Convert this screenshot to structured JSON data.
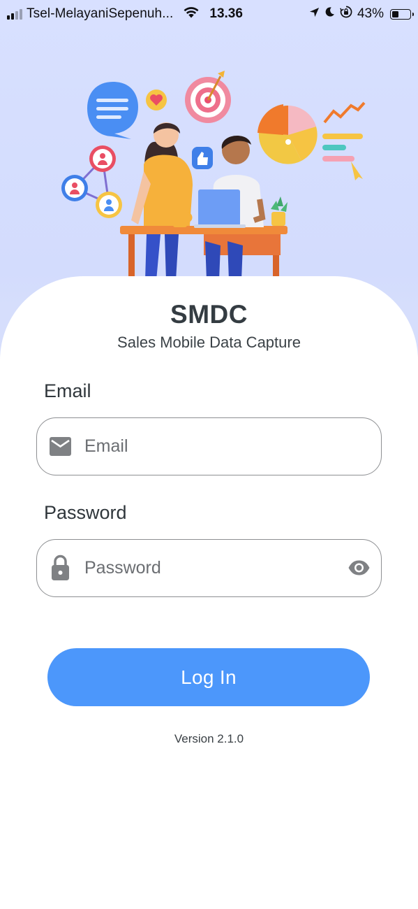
{
  "status_bar": {
    "carrier": "Tsel-MelayaniSepenuh...",
    "time": "13.36",
    "battery_percent": "43%",
    "battery_level": 0.43,
    "icons": [
      "signal-icon",
      "wifi-icon",
      "location-arrow-icon",
      "moon-icon",
      "orientation-lock-icon",
      "battery-icon"
    ]
  },
  "illustration": {
    "icon": "team-analytics-illustration"
  },
  "app": {
    "title": "SMDC",
    "subtitle": "Sales Mobile Data Capture"
  },
  "form": {
    "email": {
      "label": "Email",
      "placeholder": "Email",
      "value": "",
      "icon": "mail-icon"
    },
    "password": {
      "label": "Password",
      "placeholder": "Password",
      "value": "",
      "icon": "lock-icon",
      "toggle_icon": "eye-icon"
    },
    "submit_label": "Log In"
  },
  "version": "Version 2.1.0",
  "colors": {
    "header_background": "#d6defc",
    "primary_button": "#4c97fb",
    "input_border": "#8d8f92",
    "icon_gray": "#7f8184",
    "title_text": "#343c42"
  }
}
